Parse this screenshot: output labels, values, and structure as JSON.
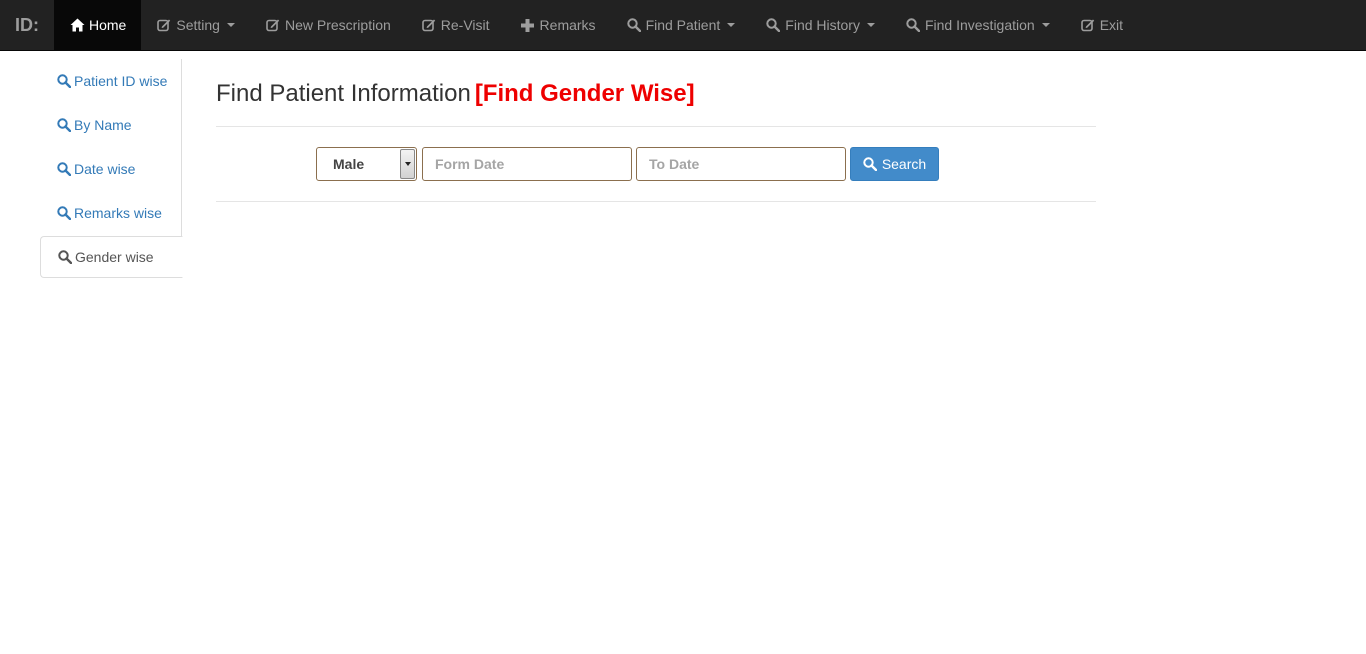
{
  "navbar": {
    "brand": "ID:",
    "items": [
      {
        "label": "Home",
        "icon": "home-icon",
        "active": true,
        "dropdown": false
      },
      {
        "label": "Setting",
        "icon": "edit-icon",
        "dropdown": true
      },
      {
        "label": "New Prescription",
        "icon": "edit-icon",
        "dropdown": false
      },
      {
        "label": "Re-Visit",
        "icon": "edit-icon",
        "dropdown": false
      },
      {
        "label": "Remarks",
        "icon": "plus-icon",
        "dropdown": false
      },
      {
        "label": "Find Patient",
        "icon": "search-icon",
        "dropdown": true
      },
      {
        "label": "Find History",
        "icon": "search-icon",
        "dropdown": true
      },
      {
        "label": "Find Investigation",
        "icon": "search-icon",
        "dropdown": true
      },
      {
        "label": "Exit",
        "icon": "edit-icon",
        "dropdown": false
      }
    ]
  },
  "sidebar": {
    "items": [
      {
        "label": "Patient ID wise",
        "icon": "search-icon"
      },
      {
        "label": "By Name",
        "icon": "search-icon"
      },
      {
        "label": "Date wise",
        "icon": "search-icon"
      },
      {
        "label": "Remarks wise",
        "icon": "search-icon"
      },
      {
        "label": "Gender wise",
        "icon": "search-icon",
        "active": true
      }
    ]
  },
  "main": {
    "title": "Find Patient Information",
    "title_accent": "[Find Gender Wise]",
    "accent_color": "#ee0000",
    "form": {
      "gender_select": "Male",
      "from_date_placeholder": "Form Date",
      "to_date_placeholder": "To Date",
      "search_label": "Search"
    }
  },
  "colors": {
    "navbar_bg": "#222222",
    "link": "#337ab7",
    "primary_button": "#428bca"
  }
}
